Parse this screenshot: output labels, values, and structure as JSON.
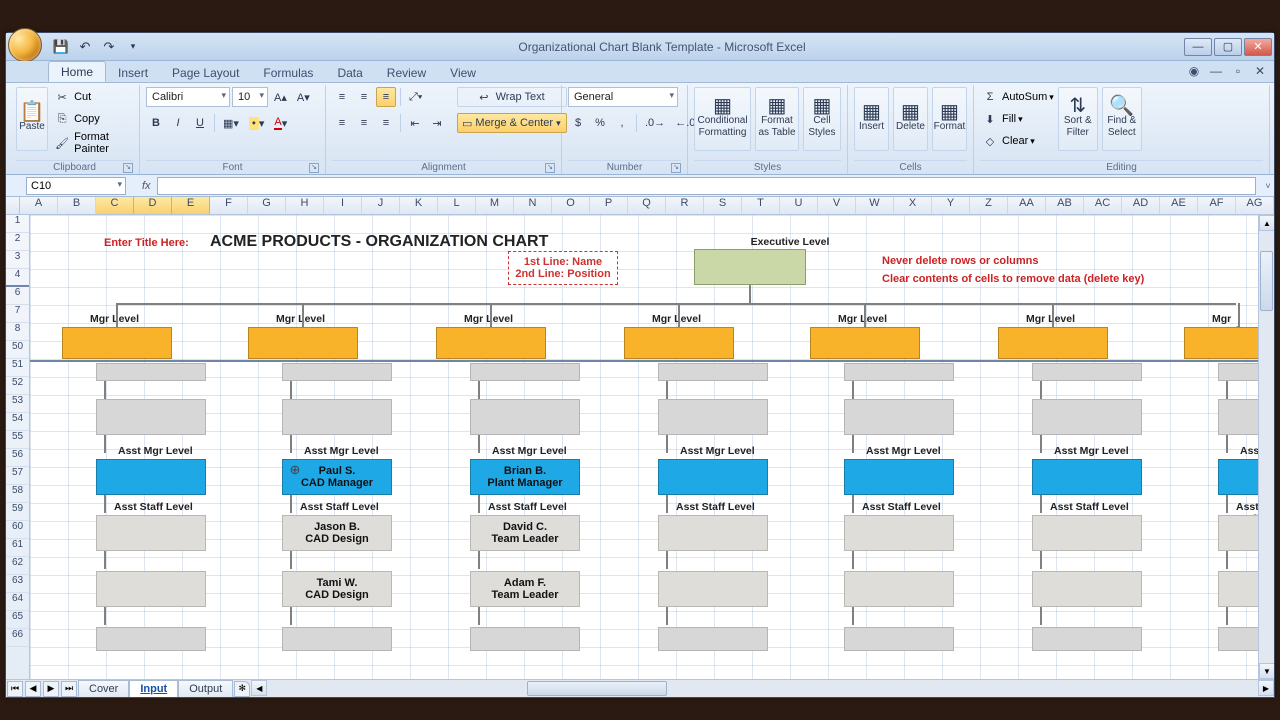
{
  "window": {
    "title": "Organizational Chart Blank Template - Microsoft Excel"
  },
  "qat": {
    "save_tip": "Save",
    "undo_tip": "Undo",
    "redo_tip": "Redo"
  },
  "tabs": {
    "home": "Home",
    "insert": "Insert",
    "page_layout": "Page Layout",
    "formulas": "Formulas",
    "data": "Data",
    "review": "Review",
    "view": "View"
  },
  "ribbon": {
    "clipboard": {
      "label": "Clipboard",
      "paste": "Paste",
      "cut": "Cut",
      "copy": "Copy",
      "format_painter": "Format Painter"
    },
    "font": {
      "label": "Font",
      "family": "Calibri",
      "size": "10",
      "btns": {
        "bold": "B",
        "italic": "I",
        "underline": "U"
      }
    },
    "alignment": {
      "label": "Alignment",
      "wrap": "Wrap Text",
      "merge": "Merge & Center"
    },
    "number": {
      "label": "Number",
      "format": "General",
      "currency": "$",
      "percent": "%",
      "comma": ","
    },
    "styles": {
      "label": "Styles",
      "conditional": "Conditional Formatting",
      "table": "Format as Table",
      "cell": "Cell Styles"
    },
    "cells": {
      "label": "Cells",
      "insert": "Insert",
      "delete": "Delete",
      "format": "Format"
    },
    "editing": {
      "label": "Editing",
      "autosum": "AutoSum",
      "fill": "Fill",
      "clear": "Clear",
      "sort": "Sort & Filter",
      "find": "Find & Select"
    }
  },
  "namebox": "C10",
  "cols": [
    "A",
    "B",
    "C",
    "D",
    "E",
    "F",
    "G",
    "H",
    "I",
    "J",
    "K",
    "L",
    "M",
    "N",
    "O",
    "P",
    "Q",
    "R",
    "S",
    "T",
    "U",
    "V",
    "W",
    "X",
    "Y",
    "Z",
    "AA",
    "AB",
    "AC",
    "AD",
    "AE",
    "AF",
    "AG"
  ],
  "cols_selected": [
    "C",
    "D",
    "E"
  ],
  "rows_top": [
    "1",
    "2",
    "3",
    "4"
  ],
  "rows_bottom": [
    "6",
    "7",
    "8",
    "50",
    "51",
    "52",
    "53",
    "54",
    "55",
    "56",
    "57",
    "58",
    "59",
    "60",
    "61",
    "62",
    "63",
    "64",
    "65",
    "66"
  ],
  "row_selected": null,
  "sheet": {
    "enter_title_here": "Enter Title Here:",
    "title": "ACME PRODUCTS - ORGANIZATION CHART",
    "legend_line1": "1st Line: Name",
    "legend_line2": "2nd Line: Position",
    "exec_label": "Executive Level",
    "note1": "Never delete rows or columns",
    "note2": "Clear contents of cells to remove data (delete key)",
    "mgr_label": "Mgr Level",
    "asst_mgr_label": "Asst Mgr Level",
    "asst_staff_label": "Asst Staff Level",
    "col2": {
      "mgr_name": "Paul S.",
      "mgr_pos": "CAD Manager",
      "s1_name": "Jason B.",
      "s1_pos": "CAD Design",
      "s2_name": "Tami W.",
      "s2_pos": "CAD Design"
    },
    "col3": {
      "mgr_name": "Brian B.",
      "mgr_pos": "Plant Manager",
      "s1_name": "David C.",
      "s1_pos": "Team Leader",
      "s2_name": "Adam F.",
      "s2_pos": "Team Leader"
    }
  },
  "sheet_tabs": {
    "cover": "Cover",
    "input": "Input",
    "output": "Output"
  }
}
